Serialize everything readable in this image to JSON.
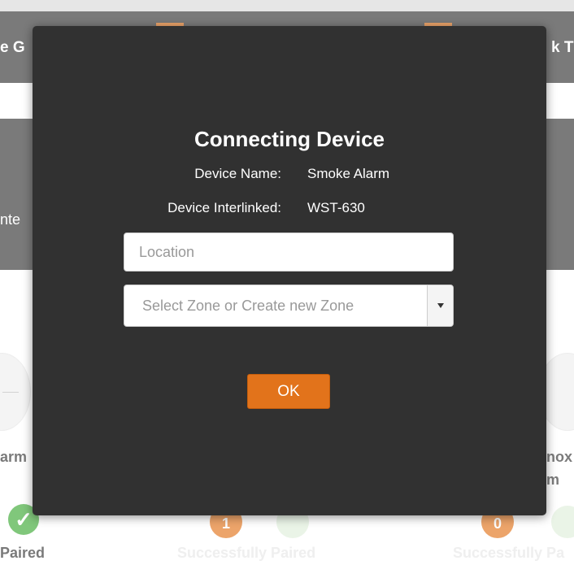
{
  "background": {
    "header_left_fragment": "e G",
    "header_right_fragment": "k T",
    "mid_left_fragment": "nte",
    "device_left_fragment": "arm",
    "device_right_fragment_1": "nox",
    "device_right_fragment_2": "m",
    "status": [
      {
        "badge": "✓",
        "label": "Paired"
      },
      {
        "badge": "1",
        "label": "Successfully Paired"
      },
      {
        "badge": "0",
        "label": "Successfully Pa"
      }
    ]
  },
  "modal": {
    "title": "Connecting Device",
    "device_name_label": "Device Name:",
    "device_name_value": "Smoke Alarm",
    "interlinked_label": "Device Interlinked:",
    "interlinked_value": "WST-630",
    "location_placeholder": "Location",
    "location_value": "",
    "zone_select_text": "Select Zone or Create new Zone",
    "ok_label": "OK"
  },
  "colors": {
    "accent": "#e2731b",
    "modal_bg": "#313131",
    "success": "#3da935"
  },
  "icons": {
    "zone_dropdown": "caret-down-icon",
    "paired_status": "checkmark-icon"
  }
}
